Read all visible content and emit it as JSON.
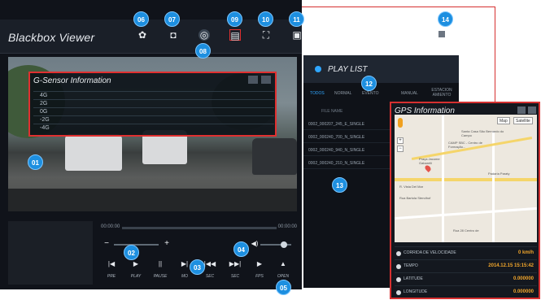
{
  "app": {
    "title": "Blackbox Viewer"
  },
  "toolbar": [
    {
      "badge": "06",
      "icon": "gear-icon",
      "glyph": "✿"
    },
    {
      "badge": "07",
      "icon": "snapshot-icon",
      "glyph": "◘"
    },
    {
      "badge": "09",
      "icon": "document-icon",
      "glyph": "▤"
    },
    {
      "badge": "10",
      "icon": "fullscreen-icon",
      "glyph": "⛶"
    },
    {
      "badge": "11",
      "icon": "map-window-icon",
      "glyph": "▣"
    },
    {
      "badge": "08",
      "icon": "gsensor-icon",
      "glyph": "◎"
    }
  ],
  "badges": {
    "b01": "01",
    "b02": "02",
    "b03": "03",
    "b04": "04",
    "b05": "05",
    "b12": "12",
    "b13": "13",
    "b14": "14"
  },
  "gsensor": {
    "title": "G-Sensor Information",
    "levels": [
      "4G",
      "2G",
      "0G",
      "-2G",
      "-4G"
    ]
  },
  "player": {
    "time_start": "00:00:00",
    "time_end": "00:00:00",
    "volume_level": 0.75,
    "controls": [
      {
        "icon": "previous-icon",
        "glyph": "|◀",
        "label": "PRE"
      },
      {
        "icon": "play-icon",
        "glyph": "▶",
        "label": "PLAY"
      },
      {
        "icon": "pause-icon",
        "glyph": "||",
        "label": "PAUSE"
      },
      {
        "icon": "move-icon",
        "glyph": "▶|",
        "label": "MO"
      },
      {
        "icon": "rewind-icon",
        "glyph": "|◀◀",
        "label": "SEC"
      },
      {
        "icon": "forward-icon",
        "glyph": "▶▶|",
        "label": "SEC"
      },
      {
        "icon": "fps-icon",
        "glyph": "▶",
        "label": "FPS"
      },
      {
        "icon": "eject-icon",
        "glyph": "▲",
        "label": "OPEN"
      }
    ]
  },
  "playlist": {
    "title": "PLAY LIST",
    "tabs": [
      "TODOS",
      "NORMAL",
      "EVENTO",
      "MANUAL",
      "ESTACION AMIENTO"
    ],
    "column": "FILE NAME",
    "items": [
      "0002_000207_245_E_SINGLE",
      "0002_000240_700_N_SINGLE",
      "0002_000240_940_N_SINGLE",
      "0002_000240_210_N_SINGLE"
    ]
  },
  "gps": {
    "title": "GPS Information",
    "map_types": [
      "Map",
      "Satellite"
    ],
    "map_labels": [
      "Santa Casa São Bernardo do Campo",
      "CAMP SBC - Centro de Formação...",
      "Praça Jacome Gabarelli",
      "Padaria Paraty",
      "R. Vista Del Mar",
      "Rua Bartola Stendhof",
      "Rua 28 Centro de"
    ],
    "rows": [
      {
        "icon": "speed-icon",
        "key": "CORRIDA DE VELOCIDADE",
        "value": "0 km/h"
      },
      {
        "icon": "time-icon",
        "key": "TEMPO",
        "value": "2014.12.15 15:15:42"
      },
      {
        "icon": "latitude-icon",
        "key": "LATITUDE",
        "value": "0.000000"
      },
      {
        "icon": "longitude-icon",
        "key": "LONGITUDE",
        "value": "0.000000"
      }
    ]
  },
  "colors": {
    "accent": "#1d8fe0",
    "highlight": "#d63030",
    "value": "#f2a62b"
  }
}
